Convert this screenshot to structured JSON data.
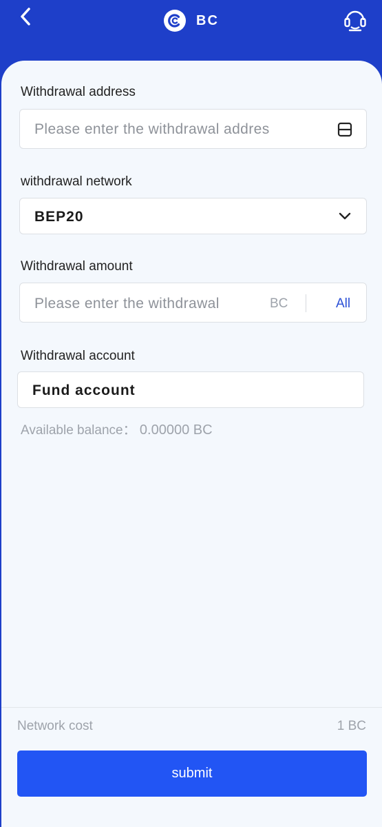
{
  "header": {
    "title": "BC",
    "back_icon": "chevron-left-icon",
    "logo_icon": "bc-coin-logo-icon",
    "support_icon": "headset-support-icon",
    "background_color": "#1e3fc9"
  },
  "form": {
    "address": {
      "label": "Withdrawal address",
      "placeholder": "Please enter the withdrawal addres",
      "scan_icon": "scan-icon"
    },
    "network": {
      "label": "withdrawal network",
      "selected": "BEP20",
      "dropdown_icon": "chevron-down-icon"
    },
    "amount": {
      "label": "Withdrawal amount",
      "placeholder": "Please enter the withdrawal",
      "unit": "BC",
      "all_label": "All"
    },
    "account": {
      "label": "Withdrawal account",
      "selected": "Fund account"
    },
    "balance": {
      "label": "Available balance：",
      "value": "0.00000 BC"
    }
  },
  "footer": {
    "network_cost_label": "Network cost",
    "network_cost_value": "1 BC",
    "submit_label": "submit",
    "accent_color": "#2255f4"
  }
}
